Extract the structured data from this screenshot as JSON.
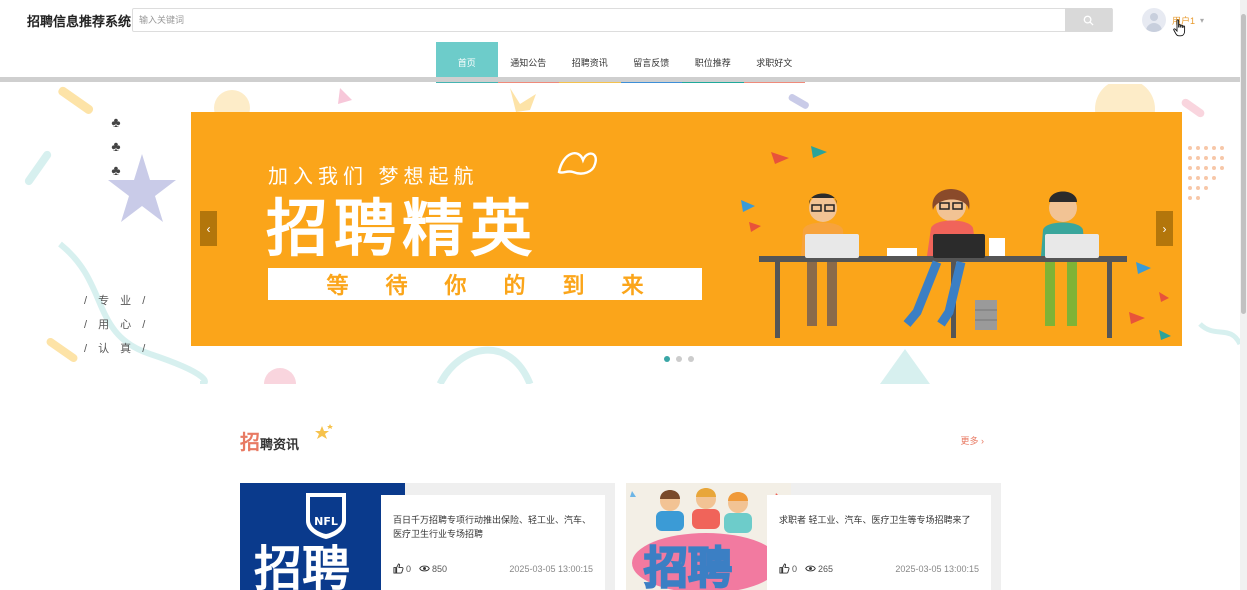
{
  "header": {
    "logo": "招聘信息推荐系统",
    "search_placeholder": "输入关键词",
    "username": "用户1",
    "caret": "▾"
  },
  "nav": {
    "items": [
      {
        "label": "首页",
        "active": true,
        "color": "#6dccca"
      },
      {
        "label": "通知公告",
        "color": "#f08a7a"
      },
      {
        "label": "招聘资讯",
        "color": "#f6c24c"
      },
      {
        "label": "留言反馈",
        "color": "#3d8fd8"
      },
      {
        "label": "职位推荐",
        "color": "#1fa99b"
      },
      {
        "label": "求职好文",
        "color": "#f08a7a"
      }
    ]
  },
  "side": {
    "slogans": [
      "/ 专 业 /",
      "/ 用 心 /",
      "/ 认 真 /"
    ]
  },
  "banner": {
    "line1": "加入我们  梦想起航",
    "title": "招聘精英",
    "strip_chars": [
      "等",
      "待",
      "你",
      "的",
      "到",
      "来"
    ],
    "slide_count": 3,
    "active_slide": 0
  },
  "section": {
    "title_big": "招",
    "title_rest": "聘资讯",
    "more": "更多 ›"
  },
  "cards": [
    {
      "title": "百日千万招聘专项行动推出保险、轻工业、汽车、医疗卫生行业专场招聘",
      "likes": "0",
      "views": "850",
      "date": "2025-03-05 13:00:15",
      "img_text": "招聘",
      "img_logo": "NFL"
    },
    {
      "title": "求职者 轻工业、汽车、医疗卫生等专场招聘来了",
      "likes": "0",
      "views": "265",
      "date": "2025-03-05 13:00:15",
      "img_text": "招聘"
    }
  ],
  "colors": {
    "accent_teal": "#6dccca",
    "banner_orange": "#fba51a",
    "section_red": "#e87a63"
  }
}
